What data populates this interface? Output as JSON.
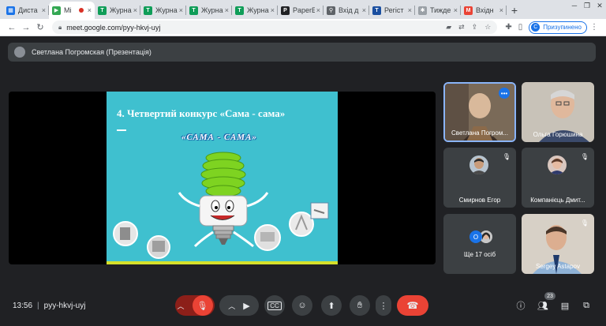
{
  "browser": {
    "tabs": [
      {
        "label": "Диста",
        "fav_color": "#1a73e8",
        "fav_glyph": "▦",
        "active": false
      },
      {
        "label": "Mi",
        "fav_color": "#34a853",
        "fav_glyph": "▶",
        "active": true,
        "recording": true
      },
      {
        "label": "Журна",
        "fav_color": "#0f9d58",
        "fav_glyph": "T",
        "active": false
      },
      {
        "label": "Журна",
        "fav_color": "#0f9d58",
        "fav_glyph": "T",
        "active": false
      },
      {
        "label": "Журна",
        "fav_color": "#0f9d58",
        "fav_glyph": "T",
        "active": false
      },
      {
        "label": "Журна",
        "fav_color": "#0f9d58",
        "fav_glyph": "T",
        "active": false
      },
      {
        "label": "PaperE",
        "fav_color": "#202124",
        "fav_glyph": "P",
        "active": false
      },
      {
        "label": "Вхід д",
        "fav_color": "#5f6368",
        "fav_glyph": "⚲",
        "active": false
      },
      {
        "label": "Регіст",
        "fav_color": "#1a4fa0",
        "fav_glyph": "T",
        "active": false
      },
      {
        "label": "Тижде",
        "fav_color": "#9aa0a6",
        "fav_glyph": "✱",
        "active": false
      },
      {
        "label": "Вхідн",
        "fav_color": "#ea4335",
        "fav_glyph": "M",
        "active": false
      }
    ],
    "url": "meet.google.com/pyy-hkvj-uyj",
    "profile_label": "Призупинено",
    "profile_initial": "C"
  },
  "meet": {
    "presenter_label": "Светлана Погромская (Презентація)",
    "slide": {
      "title": "4. Четвертий конкурс «Сама - сама»",
      "wordart": "«САМА - САМА»"
    },
    "participants": [
      {
        "name": "Светлана Погром...",
        "speaking": true
      },
      {
        "name": "Ольга Горюшина"
      },
      {
        "name": "Смирнов Егор"
      },
      {
        "name": "Компанієць Дмит..."
      },
      {
        "name": "Ще 17 осіб"
      },
      {
        "name": "Sergey Astapov"
      }
    ],
    "others_count_initial": "О",
    "clock": "13:56",
    "meeting_code": "pyy-hkvj-uyj",
    "people_count": "23",
    "colors": {
      "accent": "#1a73e8",
      "end_call": "#ea4335",
      "muted": "#8c1f19",
      "background": "#202124"
    }
  }
}
